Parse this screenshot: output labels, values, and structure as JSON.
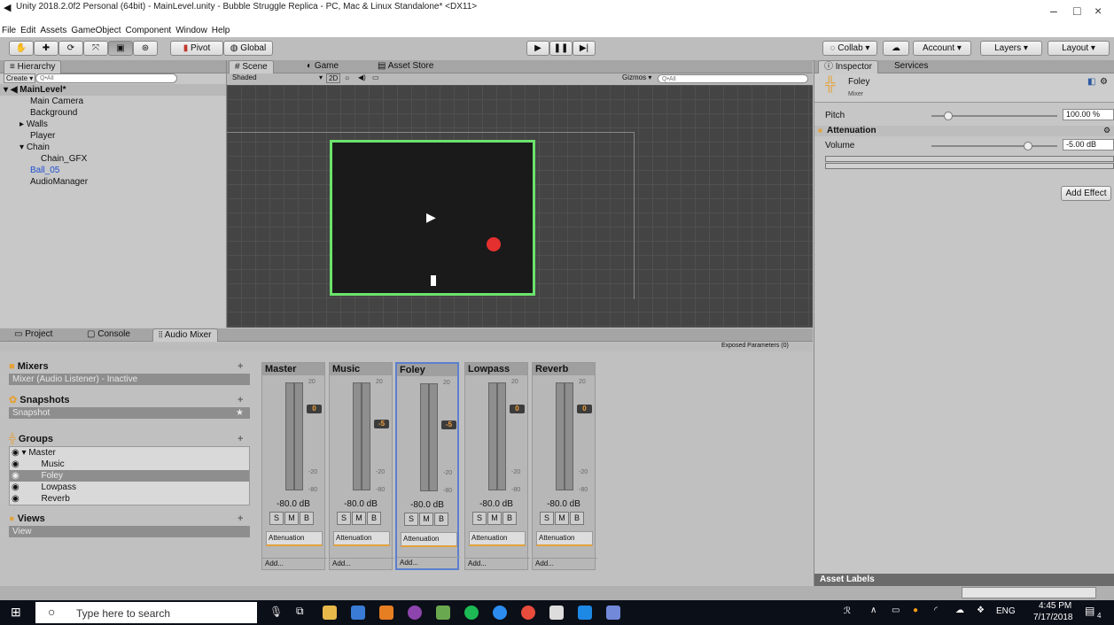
{
  "window": {
    "title": "Unity 2018.2.0f2 Personal (64bit) - MainLevel.unity - Bubble Struggle Replica - PC, Mac & Linux Standalone* <DX11>",
    "minimize": "–",
    "maximize": "□",
    "close": "×"
  },
  "menu": [
    "File",
    "Edit",
    "Assets",
    "GameObject",
    "Component",
    "Window",
    "Help"
  ],
  "toolbar": {
    "pivot": "Pivot",
    "global": "Global",
    "collab": "Collab",
    "account": "Account",
    "layers": "Layers",
    "layout": "Layout"
  },
  "hierarchy": {
    "tab": "Hierarchy",
    "create": "Create",
    "search_placeholder": "Q•All",
    "scene": "MainLevel*",
    "items": [
      "Main Camera",
      "Background",
      "Walls",
      "Player",
      "Chain",
      "Chain_GFX",
      "Ball_05",
      "AudioManager"
    ]
  },
  "scene": {
    "tabs": [
      "Scene",
      "Game",
      "Asset Store"
    ],
    "shading": "Shaded",
    "mode": "2D",
    "gizmos": "Gizmos",
    "search_placeholder": "Q•All"
  },
  "bottom": {
    "tabs": [
      "Project",
      "Console",
      "Audio Mixer"
    ],
    "exposed": "Exposed Parameters (0)",
    "mixers_title": "Mixers",
    "mixer_item": "Mixer  (Audio Listener) - Inactive",
    "snapshots_title": "Snapshots",
    "snapshot_item": "Snapshot",
    "groups_title": "Groups",
    "groups": [
      "Master",
      "Music",
      "Foley",
      "Lowpass",
      "Reverb"
    ],
    "views_title": "Views",
    "view_item": "View",
    "plus": "+"
  },
  "strips": [
    {
      "name": "Master",
      "db": "-80.0 dB",
      "fader": "0",
      "att": "Attenuation",
      "add": "Add..."
    },
    {
      "name": "Music",
      "db": "-80.0 dB",
      "fader": "-5",
      "att": "Attenuation",
      "add": "Add..."
    },
    {
      "name": "Foley",
      "db": "-80.0 dB",
      "fader": "-5",
      "att": "Attenuation",
      "add": "Add..."
    },
    {
      "name": "Lowpass",
      "db": "-80.0 dB",
      "fader": "0",
      "att": "Attenuation",
      "add": "Add..."
    },
    {
      "name": "Reverb",
      "db": "-80.0 dB",
      "fader": "0",
      "att": "Attenuation",
      "add": "Add..."
    }
  ],
  "scale": [
    "20",
    "0",
    "-20",
    "-40",
    "-60",
    "-80"
  ],
  "smb": [
    "S",
    "M",
    "B"
  ],
  "inspector": {
    "tab": "Inspector",
    "services": "Services",
    "object": "Foley",
    "subtitle": "Mixer",
    "pitch_label": "Pitch",
    "pitch_value": "100.00 %",
    "attenuation": "Attenuation",
    "volume_label": "Volume",
    "volume_value": "-5.00 dB",
    "add_effect": "Add Effect",
    "asset_labels": "Asset Labels"
  },
  "taskbar": {
    "search": "Type here to search",
    "lang": "ENG",
    "time": "4:45 PM",
    "date": "7/17/2018",
    "notif": "4"
  }
}
